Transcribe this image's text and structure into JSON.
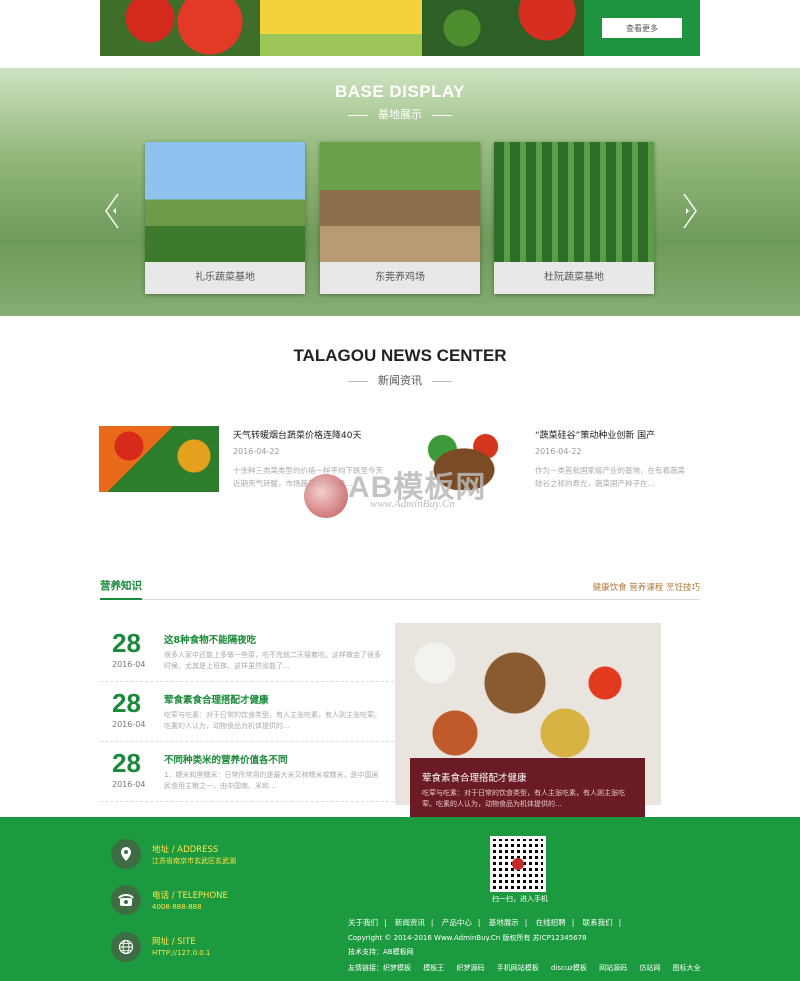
{
  "top_strip": {
    "more_button": "查看更多"
  },
  "base_display": {
    "title": "BASE DISPLAY",
    "subtitle": "基地展示",
    "cards": [
      {
        "caption": "礼乐蔬菜基地"
      },
      {
        "caption": "东莞养鸡场"
      },
      {
        "caption": "杜阮蔬菜基地"
      }
    ]
  },
  "news_center": {
    "title": "TALAGOU NEWS CENTER",
    "subtitle": "新闻资讯",
    "items": [
      {
        "title": "天气转暖烟台蔬菜价格连降40天",
        "date": "2016-04-22",
        "desc": "十余种三类菜类型的价格一样平均下跌至今天近期天气转暖，市场蔬菜日供应量..."
      },
      {
        "title": "“蔬菜硅谷”策动种业创新 国产",
        "date": "2016-04-22",
        "desc": "作为一类首批国家级产业的基地，在有着蔬菜硅谷之称的寿光，蔬菜国产种子在..."
      }
    ],
    "watermark": {
      "text": "AB模板网",
      "url": "www.AdminBuy.Cn"
    }
  },
  "nutrition": {
    "title": "营养知识",
    "links": "健康饮食 营养课程 烹饪技巧",
    "list": [
      {
        "day": "28",
        "ym": "2016-04",
        "title": "这8种食物不能隔夜吃",
        "desc": "很多人家中还能上多做一些菜，吃不完就二天接着吃，这样做会了很多时候，尤其是上班族，这样虽然省能了..."
      },
      {
        "day": "28",
        "ym": "2016-04",
        "title": "荤食素食合理搭配才健康",
        "desc": "吃荤与吃素：对于日常的饮食类型，有人主张吃素，有人则主张吃荤。吃素的人认为，动物食品为机体提供的..."
      },
      {
        "day": "28",
        "ym": "2016-04",
        "title": "不同种类米的营养价值各不同",
        "desc": "1、糯米和黑糯米：日常所常用的是最大米又称糯米或糯米，是中国居民食用主粮之一，由中国南、米和..."
      }
    ],
    "feature": {
      "title": "荤食素食合理搭配才健康",
      "desc": "吃荤与吃素：对于日常的饮食类型，有人主张吃素，有人则主张吃荤。吃素的人认为，动物食品为机体提供的..."
    }
  },
  "footer": {
    "address_label": "地址 / ADDRESS",
    "address_value": "江苏省南京市玄武区玄武湖",
    "phone_label": "电话 / TELEPHONE",
    "phone_value": "4008-888-888",
    "site_label": "网址 / SITE",
    "site_value": "HTTP://127.0.0.1",
    "qr_caption": "扫一扫，进入手机",
    "nav": [
      "关于我们",
      "|",
      "新闻资讯",
      "|",
      "产品中心",
      "|",
      "基地展示",
      "|",
      "在线招聘",
      "|",
      "联系我们",
      "|"
    ],
    "copyright": "Copyright © 2014-2016 Www.AdminBuy.Cn 版权所有  苏ICP12345678",
    "tech": "技术支持：AB模板网",
    "friend_links": [
      "友情链接：织梦模板",
      "模板王",
      "织梦源码",
      "手机网站模板",
      "discuz模板",
      "网站源码",
      "仿站网",
      "图标大全"
    ]
  }
}
